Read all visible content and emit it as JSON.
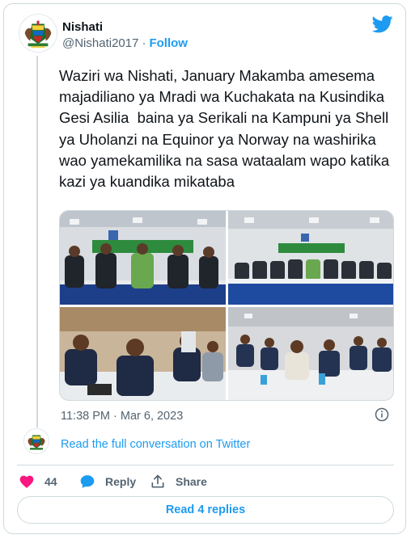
{
  "account": {
    "name": "Nishati",
    "handle": "@Nishati2017",
    "separator": "·",
    "follow_label": "Follow",
    "avatar_icon": "tanzania-coat-of-arms-logo"
  },
  "tweet": {
    "text": "Waziri wa Nishati, January Makamba amesema majadiliano ya Mradi wa Kuchakata na Kusindika Gesi Asilia  baina ya Serikali na Kampuni ya Shell ya Uholanzi na Equinor ya Norway na washirika wao yamekamilika na sasa wataalam wapo katika kazi ya kuandika mikataba",
    "timestamp": "11:38 PM · Mar 6, 2023"
  },
  "media": {
    "photos": [
      "photo-officials-standing-banner",
      "photo-head-table-panel",
      "photo-audience-seated-left",
      "photo-audience-seated-hall"
    ]
  },
  "conversation": {
    "read_full_label": "Read the full conversation on Twitter"
  },
  "actions": {
    "like_count": "44",
    "reply_label": "Reply",
    "share_label": "Share"
  },
  "read_replies_label": "Read 4 replies",
  "colors": {
    "accent": "#1d9bf0",
    "like": "#f91880",
    "text": "#0f1419",
    "muted": "#536471",
    "border": "#cfd9de"
  },
  "icons": [
    "twitter-bird-icon",
    "info-icon",
    "heart-icon",
    "reply-bubble-icon",
    "share-icon"
  ]
}
